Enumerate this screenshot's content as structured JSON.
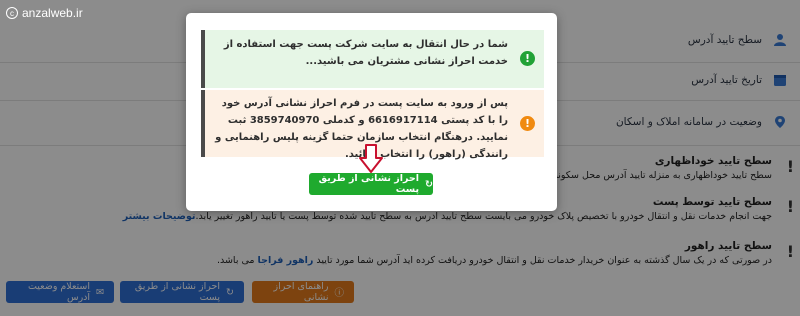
{
  "watermark": "anzalweb.ir",
  "background": {
    "rows": [
      {
        "label": "سطح تایید آدرس",
        "icon": "person-icon"
      },
      {
        "label": "تاریخ تایید آدرس",
        "icon": "calendar-icon"
      },
      {
        "label": "وضعیت در سامانه املاک و اسکان",
        "icon": "map-pin-icon"
      }
    ],
    "levels": [
      {
        "title": "سطح تایید خوداظهاری",
        "desc": "سطح تایید خوداظهاری به منزله تایید آدرس محل سکونت توس",
        "link": ""
      },
      {
        "title": "سطح تایید توسط پست",
        "desc": "جهت انجام خدمات نقل و انتقال خودرو با تخصیص پلاک خودرو می بایست سطح تایید آدرس به سطح تایید شده توسط پست یا تایید راهور تغییر یابد.",
        "link": "توضیحات بیشتر"
      },
      {
        "title": "سطح تایید راهور",
        "desc": "در صورتی که در یک سال گذشته به عنوان خریدار خدمات نقل و انتقال خودرو دریافت کرده اید آدرس شما مورد تایید",
        "link": "راهور فراجا",
        "suffix": "می باشد."
      }
    ],
    "buttons": [
      {
        "label": "استعلام وضعیت آدرس",
        "icon": "envelope-icon",
        "color": "blue"
      },
      {
        "label": "احراز نشانی از طریق پست",
        "icon": "refresh-icon",
        "color": "blue"
      },
      {
        "label": "راهنمای احراز نشانی",
        "icon": "info-icon",
        "color": "orange"
      }
    ]
  },
  "modal": {
    "alert_green": "شما در حال انتقال به سایت شرکت پست جهت استفاده از خدمت احراز نشانی مشتریان می باشید...",
    "alert_orange": "پس از ورود به سایت پست در فرم احراز نشانی آدرس خود را با کد پستی 6616917114 و کدملی 3859740970 ثبت نمایید. درهنگام انتخاب سازمان حتما گزینه پلیس راهنمایی و رانندگی (راهور) را انتخاب نمائید.",
    "button_label": "احراز نشانی از طریق پست",
    "green_badge": "!",
    "orange_badge": "!"
  },
  "colors": {
    "green": "#1faa2e",
    "orange": "#f08a10",
    "arrow": "#c8102e",
    "blue_button": "#2f6fd6"
  }
}
